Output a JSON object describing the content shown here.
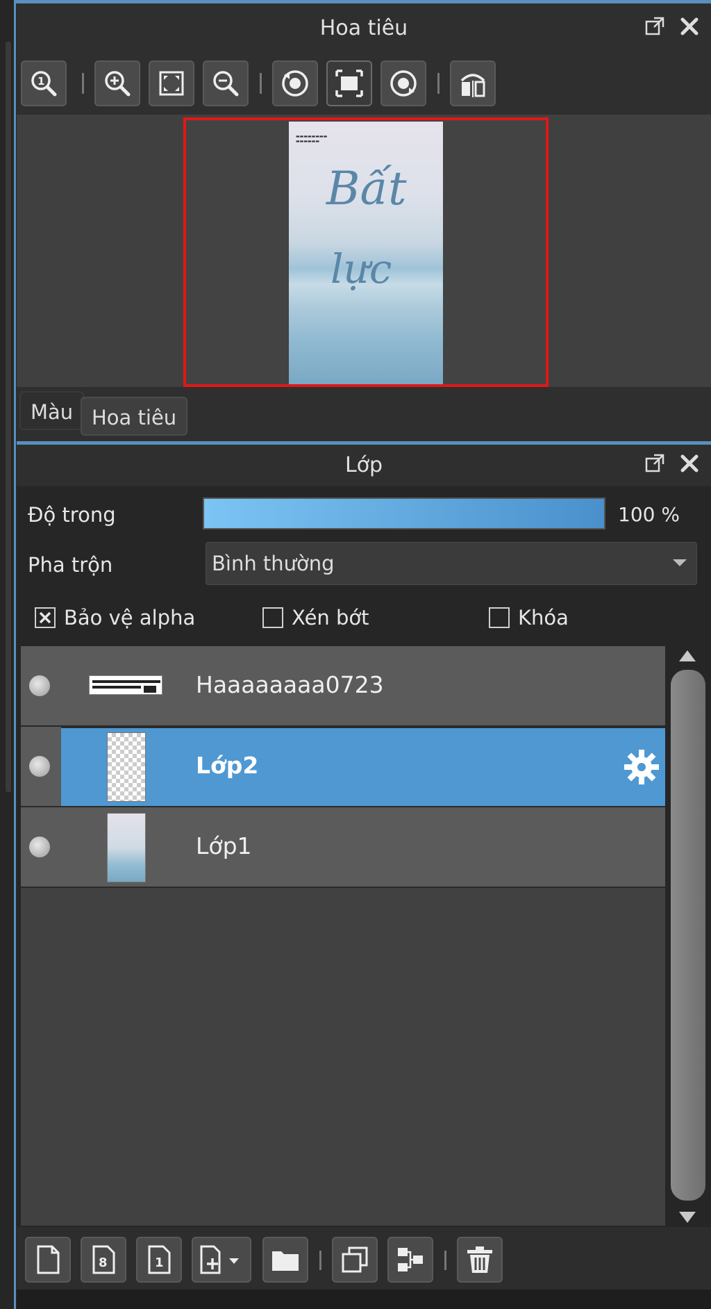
{
  "navigator": {
    "title": "Hoa tiêu",
    "canvas_text": {
      "line1": "Bất",
      "line2": "lực"
    },
    "toolbar": [
      {
        "name": "zoom-actual-size-button",
        "icon": "zoom-1x-icon"
      },
      {
        "name": "zoom-in-button",
        "icon": "zoom-in-icon"
      },
      {
        "name": "fit-to-window-button",
        "icon": "fit-window-icon"
      },
      {
        "name": "zoom-out-button",
        "icon": "zoom-out-icon"
      },
      {
        "name": "rotate-left-button",
        "icon": "rotate-left-icon"
      },
      {
        "name": "reset-view-button",
        "icon": "fit-frame-icon"
      },
      {
        "name": "rotate-right-button",
        "icon": "rotate-right-icon"
      },
      {
        "name": "flip-horizontal-button",
        "icon": "flip-horizontal-icon"
      }
    ],
    "tabs": [
      "Màu",
      "Hoa tiêu"
    ],
    "active_tab": "Hoa tiêu"
  },
  "layers": {
    "title": "Lớp",
    "opacity_label": "Độ trong",
    "opacity_value": "100 %",
    "opacity_fraction": 1.0,
    "blend_label": "Pha trộn",
    "blend_value": "Bình thường",
    "checkboxes": [
      {
        "label": "Bảo vệ alpha",
        "checked": true
      },
      {
        "label": "Xén bớt",
        "checked": false
      },
      {
        "label": "Khóa",
        "checked": false
      }
    ],
    "items": [
      {
        "name": "Haaaaaaaa0723",
        "selected": false
      },
      {
        "name": "Lớp2",
        "selected": true
      },
      {
        "name": "Lớp1",
        "selected": false
      }
    ],
    "bottom_toolbar": [
      {
        "name": "new-layer-button",
        "icon": "new-page-icon"
      },
      {
        "name": "new-8bit-layer-button",
        "icon": "layer-8-icon"
      },
      {
        "name": "new-1bit-layer-button",
        "icon": "layer-1-icon"
      },
      {
        "name": "add-layer-menu-button",
        "icon": "add-layer-dropdown-icon"
      },
      {
        "name": "new-folder-button",
        "icon": "folder-icon"
      },
      {
        "name": "duplicate-layer-button",
        "icon": "duplicate-icon"
      },
      {
        "name": "merge-down-button",
        "icon": "merge-icon"
      },
      {
        "name": "delete-layer-button",
        "icon": "trash-icon"
      }
    ]
  },
  "colors": {
    "accent": "#4f98d2",
    "frame": "#e01818",
    "panel_bg": "#3c3c3c"
  }
}
